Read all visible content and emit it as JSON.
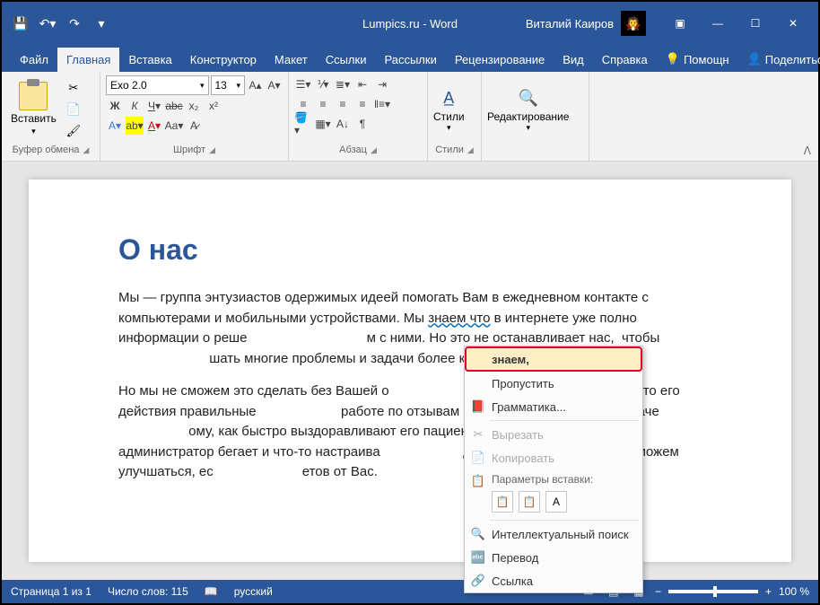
{
  "title_bar": {
    "document_title": "Lumpics.ru - Word",
    "user_name": "Виталий Каиров"
  },
  "tabs": {
    "items": [
      "Файл",
      "Главная",
      "Вставка",
      "Конструктор",
      "Макет",
      "Ссылки",
      "Рассылки",
      "Рецензирование",
      "Вид",
      "Справка"
    ],
    "active_index": 1,
    "help": "Помощн",
    "share": "Поделиться"
  },
  "ribbon": {
    "clipboard": {
      "label": "Буфер обмена",
      "paste": "Вставить"
    },
    "font": {
      "label": "Шрифт",
      "name": "Exo 2.0",
      "size": "13"
    },
    "paragraph": {
      "label": "Абзац"
    },
    "styles": {
      "label": "Стили",
      "btn": "Стили"
    },
    "editing": {
      "label": "",
      "btn": "Редактирование"
    }
  },
  "document": {
    "heading": "О нас",
    "para1": "Мы — группа энтузиастов одержимых идеей помогать Вам в ежедневном контакте с компьютерами и мобильными устройствами. Мы знаем что в интернете уже полно информации о решении разных проблем с ними. Но это не останавливает нас, чтобы попытаться решать многие проблемы и задачи более качественно.",
    "para2": "Но мы не сможем это сделать без Вашей оценки. Каждому человеку важно знать, что его действия правильные. Мы судим о работе по отзывам читателей. Доктор судит о качестве своей работы по тому, как быстро выздоравливают его пациенты. Человек, который администратор бегает и что-то настраивает, значит он делает работу. Так и мы не можем улучшаться, если не получаем ответов от Вас."
  },
  "context_menu": {
    "suggestion": "знаем,",
    "skip": "Пропустить",
    "grammar": "Грамматика...",
    "cut": "Вырезать",
    "copy": "Копировать",
    "paste_options": "Параметры вставки:",
    "smart_lookup": "Интеллектуальный поиск",
    "translate": "Перевод",
    "link": "Ссылка"
  },
  "status_bar": {
    "page": "Страница 1 из 1",
    "words": "Число слов: 115",
    "language": "русский",
    "zoom": "100 %"
  }
}
